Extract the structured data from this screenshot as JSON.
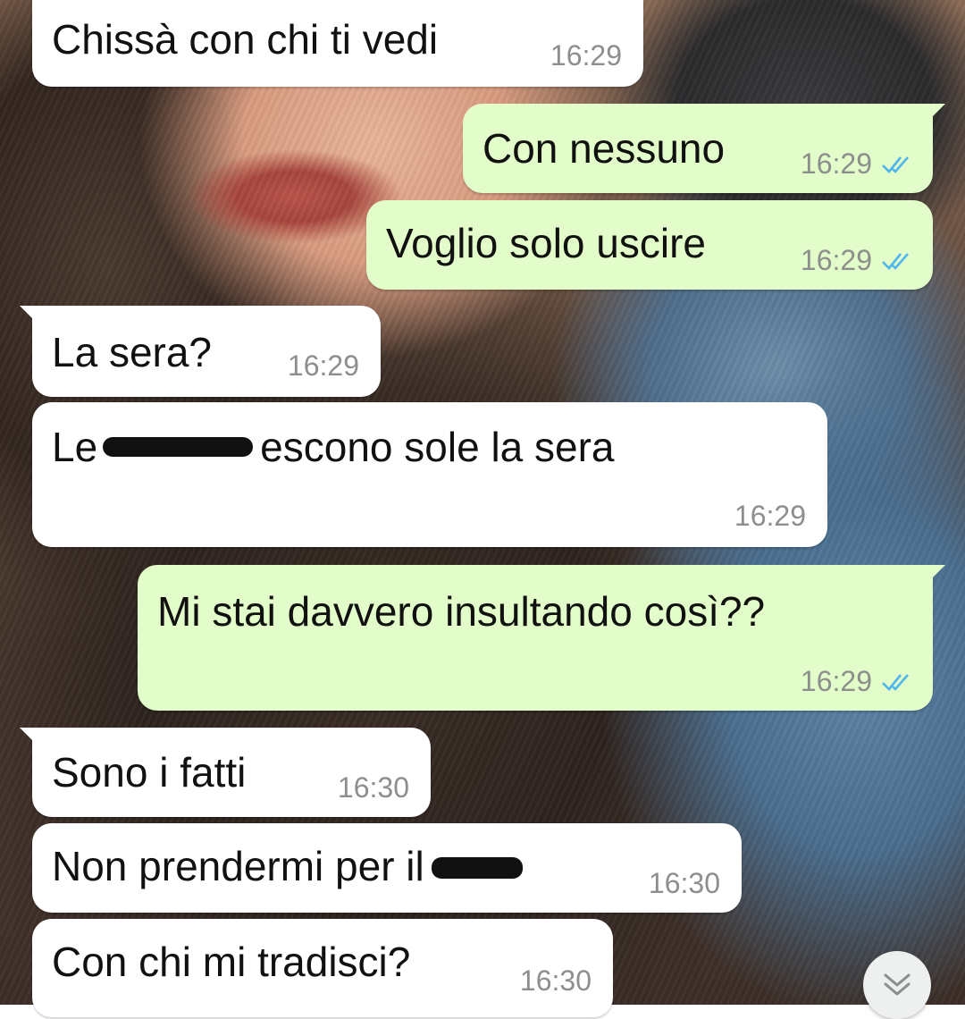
{
  "chat": {
    "messages": [
      {
        "direction": "incoming",
        "text": "Chissà con chi ti vedi",
        "time": "16:29"
      },
      {
        "direction": "outgoing",
        "text": "Con nessuno",
        "time": "16:29",
        "status": "read"
      },
      {
        "direction": "outgoing",
        "text": "Voglio solo uscire",
        "time": "16:29",
        "status": "read"
      },
      {
        "direction": "incoming",
        "text": "La sera?",
        "time": "16:29"
      },
      {
        "direction": "incoming",
        "text_before": "Le",
        "text_after": "escono sole la sera",
        "time": "16:29",
        "redacted": true
      },
      {
        "direction": "outgoing",
        "text": "Mi stai davvero insultando così??",
        "time": "16:29",
        "status": "read"
      },
      {
        "direction": "incoming",
        "text": "Sono i fatti",
        "time": "16:30"
      },
      {
        "direction": "incoming",
        "text_before": "Non prendermi per il",
        "time": "16:30",
        "redacted": true
      },
      {
        "direction": "incoming",
        "text": "Con chi mi tradisci?",
        "time": "16:30"
      }
    ]
  },
  "colors": {
    "incoming_bubble": "#ffffff",
    "outgoing_bubble": "#e2fdc9",
    "timestamp": "#8d8f8d",
    "read_ticks": "#4fb6ec"
  },
  "icons": {
    "read_receipt": "double-check-icon",
    "scroll_down": "chevron-double-down-icon"
  }
}
